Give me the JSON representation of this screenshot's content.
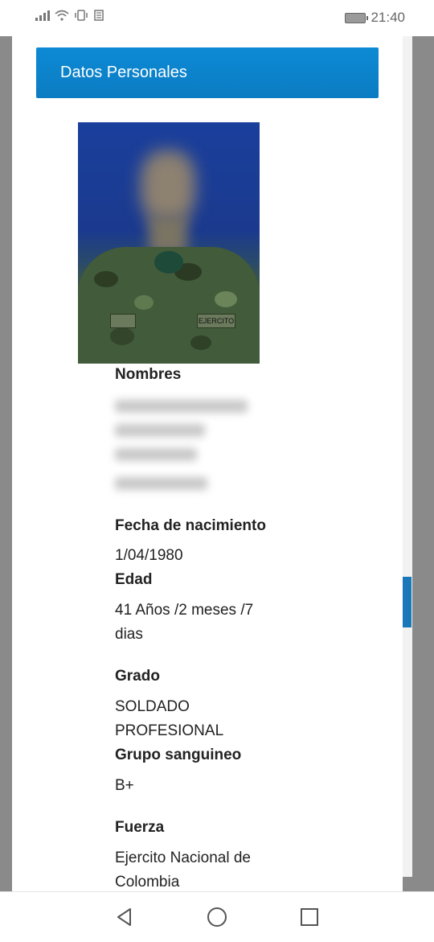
{
  "status_bar": {
    "time": "21:40"
  },
  "card": {
    "title": "Datos Personales"
  },
  "photo_tags": {
    "name_tag": "EJERCITO"
  },
  "fields": {
    "nombres_label": "Nombres",
    "fecha_label": "Fecha de nacimiento",
    "fecha_value": "1/04/1980",
    "edad_label": "Edad",
    "edad_value": "41 Años /2 meses /7 dias",
    "grado_label": "Grado",
    "grado_value": "SOLDADO PROFESIONAL",
    "grupo_label": "Grupo sanguineo",
    "grupo_value": "B+",
    "fuerza_label": "Fuerza",
    "fuerza_value": "Ejercito Nacional de Colombia"
  },
  "colors": {
    "header_blue": "#0b84cc",
    "background": "#8a8a8a"
  },
  "icons": [
    "signal-icon",
    "wifi-icon",
    "vibrate-icon",
    "notification-icon",
    "battery-icon",
    "back-icon",
    "home-icon",
    "recents-icon"
  ]
}
